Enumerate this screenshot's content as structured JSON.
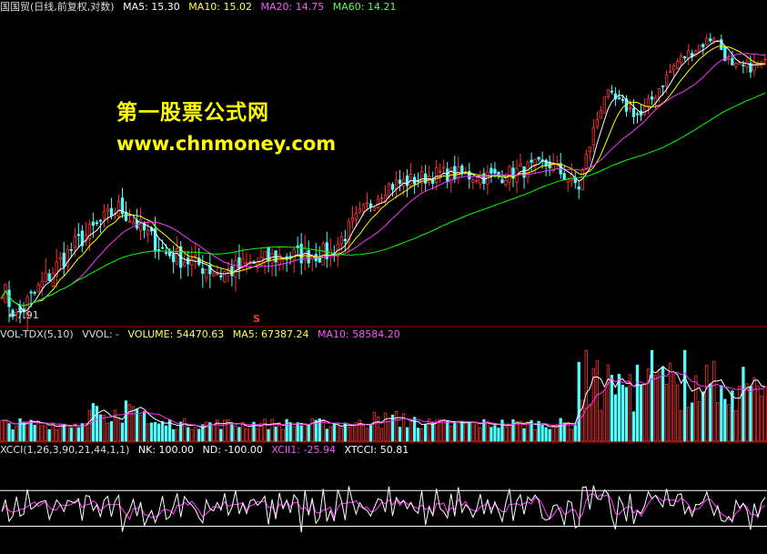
{
  "price_legend": {
    "title": "国国贸(日线,前复权,对数)",
    "ma5": "MA5: 15.30",
    "ma10": "MA10: 15.02",
    "ma20": "MA20: 14.75",
    "ma60": "MA60: 14.21"
  },
  "vol_legend": {
    "title": "VOL-TDX(5,10)",
    "vvol": "VVOL: -",
    "volume": "VOLUME: 54470.63",
    "ma5": "MA5: 67387.24",
    "ma10": "MA10: 58584.20"
  },
  "xcci_legend": {
    "title": "XCCI(1,26,3,90,21,44,1,1)",
    "nk": "NK: 100.00",
    "nd": "ND: -100.00",
    "xcii1": "XCII1: -25.94",
    "xtcci": "XTCCI: 50.81"
  },
  "watermark": {
    "line1": "第一股票公式网",
    "line2": "www.chnmoney.com"
  },
  "low_label": "←7.91",
  "signal_mark": "S",
  "colors": {
    "up": "#ff3333",
    "down": "#54ffff",
    "ma5": "#ffffff",
    "ma10": "#ffff00",
    "ma20": "#ff33ff",
    "ma60": "#00ff00",
    "separator": "#b00000",
    "legend_ma5": "#ffffff",
    "legend_ma10": "#ffff55",
    "legend_ma20": "#ff55ff",
    "legend_ma60": "#55ff55"
  },
  "chart_data": {
    "type": "candlestick",
    "price_range": [
      7.9,
      17.5
    ],
    "price_key_points": [
      {
        "bar": 0,
        "price": 8.6
      },
      {
        "bar": 4,
        "price": 7.91
      },
      {
        "bar": 20,
        "price": 9.6
      },
      {
        "bar": 32,
        "price": 10.6
      },
      {
        "bar": 45,
        "price": 9.4
      },
      {
        "bar": 60,
        "price": 8.9
      },
      {
        "bar": 75,
        "price": 9.3
      },
      {
        "bar": 90,
        "price": 9.4
      },
      {
        "bar": 105,
        "price": 11.2
      },
      {
        "bar": 120,
        "price": 11.6
      },
      {
        "bar": 135,
        "price": 11.5
      },
      {
        "bar": 150,
        "price": 11.9
      },
      {
        "bar": 158,
        "price": 11.2
      },
      {
        "bar": 165,
        "price": 14.3
      },
      {
        "bar": 175,
        "price": 13.5
      },
      {
        "bar": 185,
        "price": 15.6
      },
      {
        "bar": 195,
        "price": 16.7
      },
      {
        "bar": 200,
        "price": 15.3
      },
      {
        "bar": 209,
        "price": 15.5
      }
    ],
    "xcci_bands": {
      "nk": 100.0,
      "nd": -100.0
    },
    "last_values": {
      "ma5": 15.3,
      "ma10": 15.02,
      "ma20": 14.75,
      "ma60": 14.21,
      "volume": 54470.63,
      "vol_ma5": 67387.24,
      "vol_ma10": 58584.2,
      "xcii1": -25.94,
      "xtcci": 50.81
    }
  }
}
